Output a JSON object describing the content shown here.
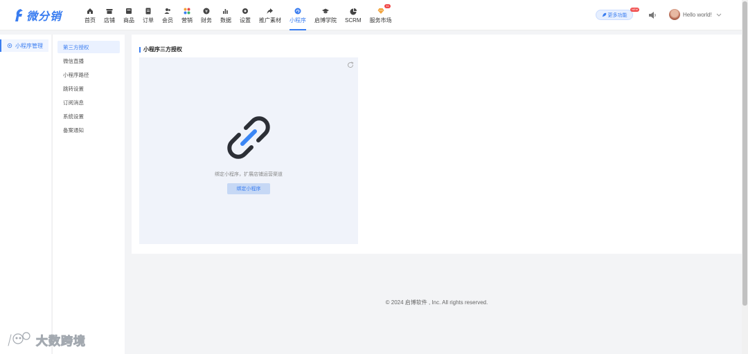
{
  "app": {
    "logo_text": "微分销"
  },
  "nav": [
    {
      "label": "首页",
      "icon": "home-icon"
    },
    {
      "label": "店铺",
      "icon": "store-icon"
    },
    {
      "label": "商品",
      "icon": "product-icon"
    },
    {
      "label": "订单",
      "icon": "order-icon"
    },
    {
      "label": "会员",
      "icon": "member-icon"
    },
    {
      "label": "营销",
      "icon": "marketing-icon"
    },
    {
      "label": "财务",
      "icon": "finance-icon"
    },
    {
      "label": "数据",
      "icon": "data-icon"
    },
    {
      "label": "设置",
      "icon": "settings-icon"
    },
    {
      "label": "推广素材",
      "icon": "share-icon"
    },
    {
      "label": "小程序",
      "icon": "mini-program-icon",
      "active": true
    },
    {
      "label": "启博学院",
      "icon": "academy-icon"
    },
    {
      "label": "SCRM",
      "icon": "scrm-icon"
    },
    {
      "label": "服务市场",
      "icon": "market-icon",
      "badge": "11"
    }
  ],
  "header": {
    "more_features": "更多功能",
    "new_badge": "NEW",
    "user_name": "Hello world!"
  },
  "rail": {
    "items": [
      {
        "label": "小程序管理",
        "icon": "gear-icon"
      }
    ]
  },
  "submenu": {
    "items": [
      {
        "label": "第三方授权",
        "active": true
      },
      {
        "label": "微信直播"
      },
      {
        "label": "小程序路径"
      },
      {
        "label": "跳转设置"
      },
      {
        "label": "订阅消息"
      },
      {
        "label": "系统设置"
      },
      {
        "label": "备案通知"
      }
    ]
  },
  "main": {
    "title": "小程序三方授权",
    "description": "绑定小程序，扩展店铺运营渠道",
    "bind_button": "绑定小程序"
  },
  "footer": {
    "copyright": "© 2024 启博软件 , Inc. All rights reserved."
  },
  "watermark": {
    "text": "大数跨境"
  },
  "colors": {
    "accent": "#3a7df0",
    "panel_bg": "#f0f3fa",
    "page_bg": "#f3f4f6"
  }
}
